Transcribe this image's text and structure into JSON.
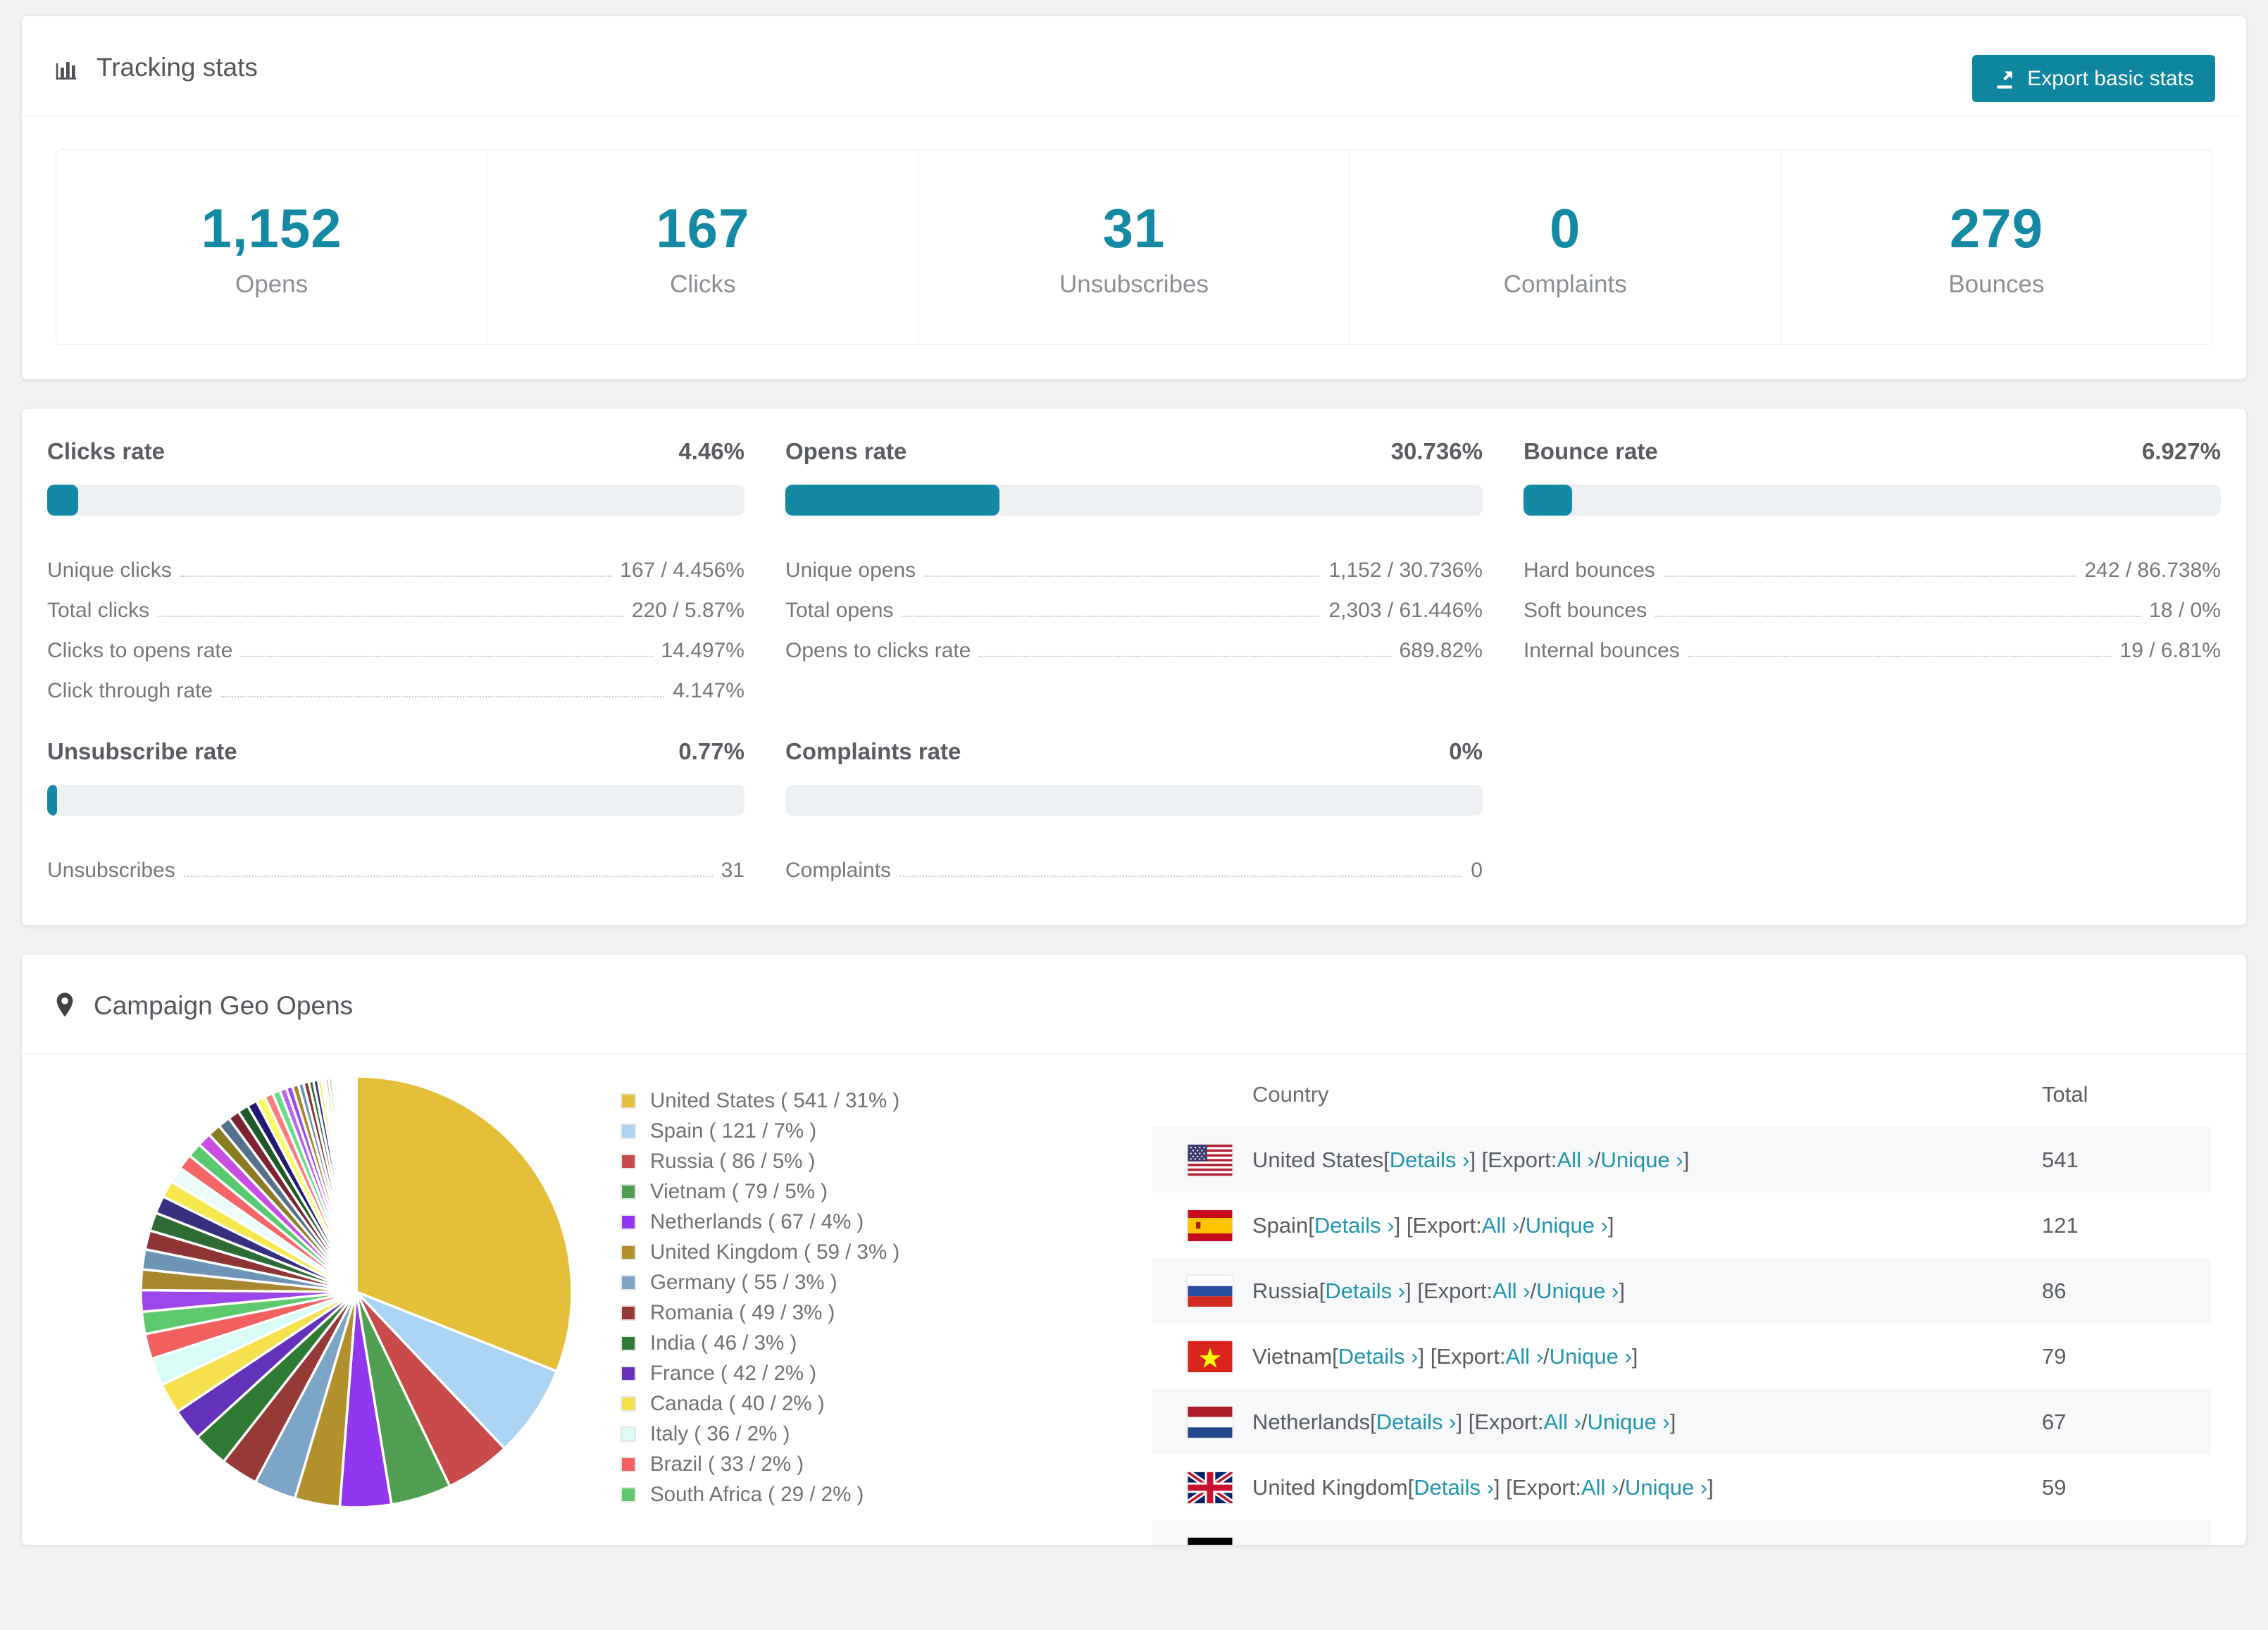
{
  "colors": {
    "accent": "#1389a4",
    "button": "#0e86a0",
    "link": "#2095af",
    "page_bg": "#eff1f3"
  },
  "tracking_card": {
    "title": "Tracking stats",
    "export_button": "Export basic stats",
    "stats": [
      {
        "value": "1,152",
        "label": "Opens"
      },
      {
        "value": "167",
        "label": "Clicks"
      },
      {
        "value": "31",
        "label": "Unsubscribes"
      },
      {
        "value": "0",
        "label": "Complaints"
      },
      {
        "value": "279",
        "label": "Bounces"
      }
    ]
  },
  "rates_card": {
    "blocks": [
      {
        "title": "Clicks rate",
        "value": "4.46%",
        "fill_pct": 4.46,
        "rows": [
          [
            "Unique clicks",
            "167 / 4.456%"
          ],
          [
            "Total clicks",
            "220 / 5.87%"
          ],
          [
            "Clicks to opens rate",
            "14.497%"
          ],
          [
            "Click through rate",
            "4.147%"
          ]
        ]
      },
      {
        "title": "Opens rate",
        "value": "30.736%",
        "fill_pct": 30.736,
        "rows": [
          [
            "Unique opens",
            "1,152 / 30.736%"
          ],
          [
            "Total opens",
            "2,303 / 61.446%"
          ],
          [
            "Opens to clicks rate",
            "689.82%"
          ]
        ]
      },
      {
        "title": "Bounce rate",
        "value": "6.927%",
        "fill_pct": 6.927,
        "rows": [
          [
            "Hard bounces",
            "242 / 86.738%"
          ],
          [
            "Soft bounces",
            "18 / 0%"
          ],
          [
            "Internal bounces",
            "19 / 6.81%"
          ]
        ]
      },
      {
        "title": "Unsubscribe rate",
        "value": "0.77%",
        "fill_pct": 0.77,
        "rows": [
          [
            "Unsubscribes",
            "31"
          ]
        ]
      },
      {
        "title": "Complaints rate",
        "value": "0%",
        "fill_pct": 0,
        "rows": [
          [
            "Complaints",
            "0"
          ]
        ]
      }
    ]
  },
  "geo_card": {
    "title": "Campaign Geo Opens",
    "legend_sep": {
      "open": " ( ",
      "mid": " / ",
      "close": " )"
    },
    "table": {
      "headers": [
        "Country",
        "Total"
      ],
      "link_labels": {
        "details": "Details",
        "export": "Export: ",
        "all": "All",
        "unique": "Unique"
      },
      "chevron": " ›",
      "sep": {
        "s1": " [",
        "s2": "] [",
        "s3": " / ",
        "s4": "]"
      },
      "rows": [
        {
          "country": "United States",
          "flag": "us",
          "total": "541",
          "alt": true,
          "clipped": false
        },
        {
          "country": "Spain",
          "flag": "es",
          "total": "121",
          "alt": false,
          "clipped": false
        },
        {
          "country": "Russia",
          "flag": "ru",
          "total": "86",
          "alt": true,
          "clipped": false
        },
        {
          "country": "Vietnam",
          "flag": "vn",
          "total": "79",
          "alt": false,
          "clipped": false
        },
        {
          "country": "Netherlands",
          "flag": "nl",
          "total": "67",
          "alt": true,
          "clipped": false
        },
        {
          "country": "United Kingdom",
          "flag": "gb",
          "total": "59",
          "alt": false,
          "clipped": false
        },
        {
          "country": "",
          "flag": "de",
          "total": "",
          "alt": true,
          "clipped": true
        }
      ]
    }
  },
  "chart_data": {
    "type": "pie",
    "title": "Campaign Geo Opens",
    "legend_position": "right",
    "start_angle_deg": -90,
    "direction": "clockwise",
    "slices": [
      {
        "label": "United States",
        "value": 541,
        "pct": "31%",
        "color": "#e4c03a"
      },
      {
        "label": "Spain",
        "value": 121,
        "pct": "7%",
        "color": "#abd4f4"
      },
      {
        "label": "Russia",
        "value": 86,
        "pct": "5%",
        "color": "#c84a4b"
      },
      {
        "label": "Vietnam",
        "value": 79,
        "pct": "5%",
        "color": "#4f9e51"
      },
      {
        "label": "Netherlands",
        "value": 67,
        "pct": "4%",
        "color": "#9137ef"
      },
      {
        "label": "United Kingdom",
        "value": 59,
        "pct": "3%",
        "color": "#b2902c"
      },
      {
        "label": "Germany",
        "value": 55,
        "pct": "3%",
        "color": "#7ca4c6"
      },
      {
        "label": "Romania",
        "value": 49,
        "pct": "3%",
        "color": "#963a38"
      },
      {
        "label": "India",
        "value": 46,
        "pct": "3%",
        "color": "#2f7b35"
      },
      {
        "label": "France",
        "value": 42,
        "pct": "2%",
        "color": "#6432ba"
      },
      {
        "label": "Canada",
        "value": 40,
        "pct": "2%",
        "color": "#f6e04e"
      },
      {
        "label": "Italy",
        "value": 36,
        "pct": "2%",
        "color": "#dafcf6"
      },
      {
        "label": "Brazil",
        "value": 33,
        "pct": "2%",
        "color": "#f2605f"
      },
      {
        "label": "South Africa",
        "value": 29,
        "pct": "2%",
        "color": "#5dc96c"
      }
    ],
    "other_slices_estimated": {
      "note": "unlabeled thin slices fanning to 12 o'clock",
      "values": [
        28,
        27,
        26,
        25,
        24,
        23,
        22,
        21,
        20,
        19,
        18,
        17,
        16,
        15,
        14,
        13,
        12,
        11,
        10,
        9,
        8,
        8,
        7,
        7,
        6,
        6,
        5,
        5,
        4,
        4,
        3,
        3,
        3,
        2,
        2,
        2,
        2,
        1,
        1,
        1,
        1,
        1,
        1,
        1,
        1,
        1,
        1,
        1,
        1,
        1,
        1,
        1
      ],
      "palette": [
        "#9d46ea",
        "#a8882f",
        "#6f93b5",
        "#8e3434",
        "#2f6b35",
        "#37307f",
        "#f7e84d",
        "#eefbfb",
        "#f56767",
        "#58c96e",
        "#c94fe3",
        "#8a7a22",
        "#55708b",
        "#7c2230",
        "#1d5a26",
        "#221a6e",
        "#fdfd66",
        "#fc7b7b",
        "#66dd88",
        "#b765f0"
      ]
    }
  }
}
